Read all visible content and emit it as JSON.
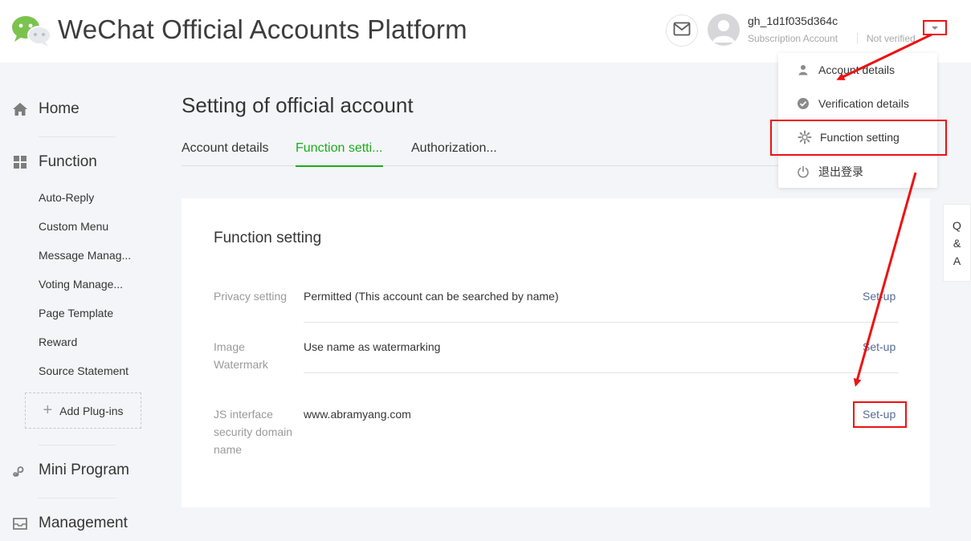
{
  "header": {
    "brand": "WeChat Official Accounts Platform",
    "account_name": "gh_1d1f035d364c",
    "account_type": "Subscription Account",
    "verification": "Not verified"
  },
  "sidebar": {
    "home": "Home",
    "function": "Function",
    "function_items": [
      "Auto-Reply",
      "Custom Menu",
      "Message Manag...",
      "Voting Manage...",
      "Page Template",
      "Reward",
      "Source Statement"
    ],
    "add_plugins": "Add Plug-ins",
    "mini_program": "Mini Program",
    "management": "Management"
  },
  "main": {
    "title": "Setting of official account",
    "tabs": [
      "Account details",
      "Function setti...",
      "Authorization..."
    ],
    "active_tab": 1
  },
  "card": {
    "title": "Function setting",
    "rows": [
      {
        "label": "Privacy setting",
        "value": "Permitted (This account can be searched by name)",
        "action": "Set-up"
      },
      {
        "label": "Image Watermark",
        "value": "Use name as watermarking",
        "action": "Set-up"
      },
      {
        "label": "JS interface security domain name",
        "value": "www.abramyang.com",
        "action": "Set-up"
      }
    ]
  },
  "qa": [
    "Q",
    "&",
    "A"
  ],
  "menu": {
    "items": [
      "Account details",
      "Verification details",
      "Function setting",
      "退出登录"
    ]
  },
  "colors": {
    "accent_green": "#1aad19",
    "link_blue": "#576b95",
    "annotation_red": "#ee1111"
  },
  "icons": [
    "wechat-logo-icon",
    "mail-icon",
    "user-avatar-icon",
    "chevron-down-icon",
    "home-icon",
    "grid-icon",
    "mini-program-icon",
    "inbox-icon",
    "person-icon",
    "check-circle-icon",
    "gear-icon",
    "power-icon"
  ]
}
